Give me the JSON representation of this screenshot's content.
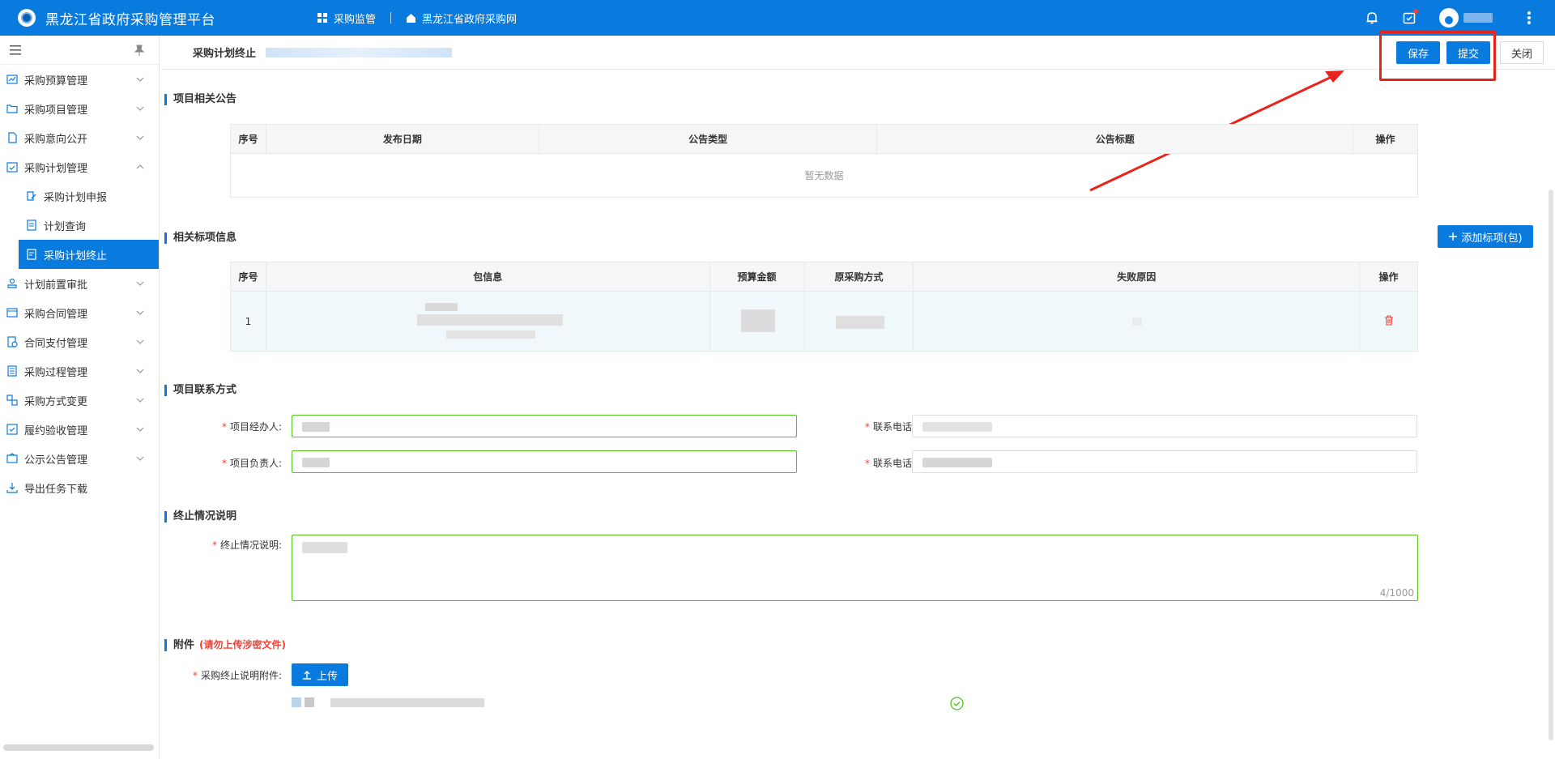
{
  "app": {
    "title": "黑龙江省政府采购管理平台"
  },
  "topnav": {
    "monitor": "采购监管",
    "website": "黑龙江省政府采购网"
  },
  "sidebar": {
    "items": [
      {
        "label": "采购预算管理",
        "icon": "chart-icon"
      },
      {
        "label": "采购项目管理",
        "icon": "folder-icon"
      },
      {
        "label": "采购意向公开",
        "icon": "doc-icon"
      },
      {
        "label": "采购计划管理",
        "icon": "calendar-check-icon"
      },
      {
        "label": "采购计划申报",
        "icon": "edit-doc-icon"
      },
      {
        "label": "计划查询",
        "icon": "doc-icon"
      },
      {
        "label": "采购计划终止",
        "icon": "doc-stop-icon"
      },
      {
        "label": "计划前置审批",
        "icon": "stamp-icon"
      },
      {
        "label": "采购合同管理",
        "icon": "contract-icon"
      },
      {
        "label": "合同支付管理",
        "icon": "pay-icon"
      },
      {
        "label": "采购过程管理",
        "icon": "process-icon"
      },
      {
        "label": "采购方式变更",
        "icon": "swap-icon"
      },
      {
        "label": "履约验收管理",
        "icon": "check-doc-icon"
      },
      {
        "label": "公示公告管理",
        "icon": "notice-icon"
      },
      {
        "label": "导出任务下载",
        "icon": "download-icon"
      }
    ]
  },
  "page": {
    "title": "采购计划终止"
  },
  "buttons": {
    "save": "保存",
    "submit": "提交",
    "close": "关闭",
    "add_section": "添加标项(包)",
    "upload": "上传"
  },
  "announcements": {
    "title": "项目相关公告",
    "columns": [
      "序号",
      "发布日期",
      "公告类型",
      "公告标题",
      "操作"
    ],
    "empty": "暂无数据"
  },
  "sections": {
    "title": "相关标项信息",
    "columns": [
      "序号",
      "包信息",
      "预算金额",
      "原采购方式",
      "失败原因",
      "操作"
    ],
    "rows": [
      {
        "index": "1"
      }
    ]
  },
  "contact": {
    "title": "项目联系方式",
    "manager_label": "项目经办人:",
    "phone_label": "联系电话:",
    "leader_label": "项目负责人:",
    "phone2_label": "联系电话:"
  },
  "termination": {
    "title": "终止情况说明",
    "label": "终止情况说明:",
    "count": "4/1000"
  },
  "attachments": {
    "title": "附件",
    "hint": "(请勿上传涉密文件)",
    "label": "采购终止说明附件:"
  },
  "colors": {
    "primary": "#0a7bde",
    "danger": "#f04134",
    "success": "#52c41a",
    "highlight": "#e8231b"
  }
}
